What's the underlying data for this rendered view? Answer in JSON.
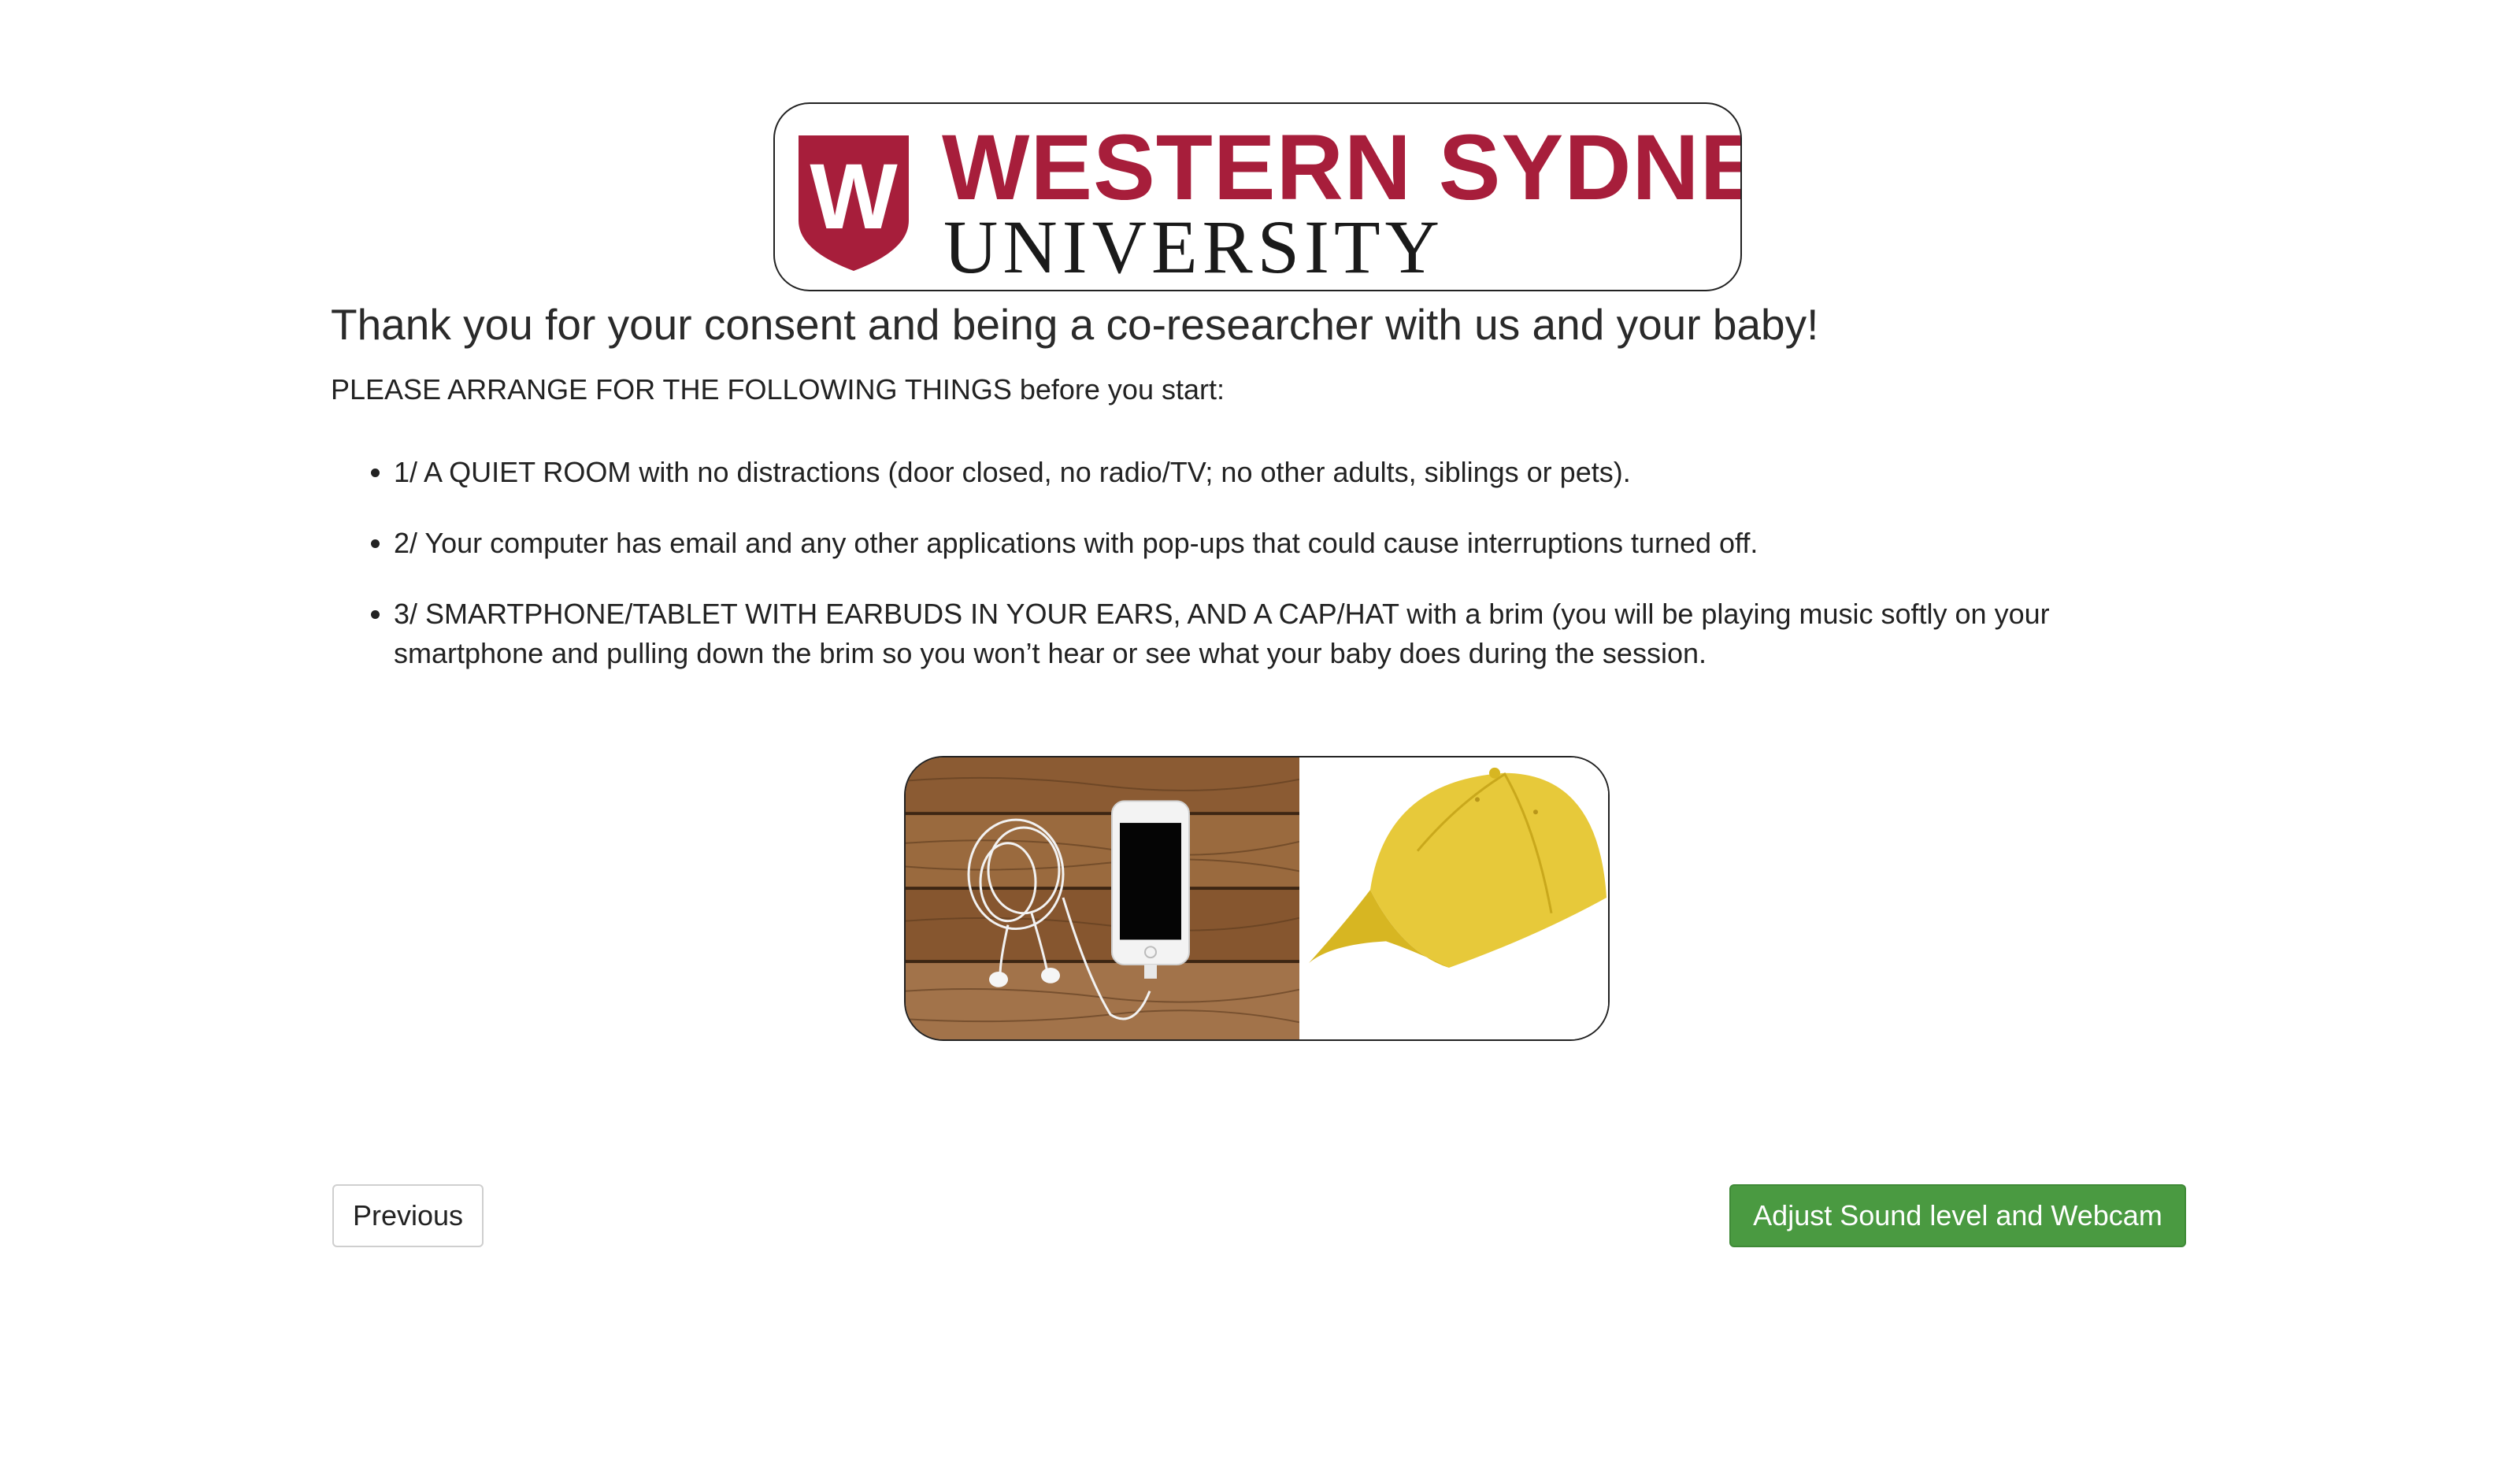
{
  "logo": {
    "shield_letter": "W",
    "line1": "WESTERN SYDNEY",
    "line2": "UNIVERSITY",
    "brand_color": "#a71e3b"
  },
  "main": {
    "headline": "Thank you for your consent and being a co-researcher with us and your baby!",
    "instructions": "PLEASE ARRANGE FOR THE FOLLOWING THINGS before you start:",
    "items": [
      "1/ A QUIET ROOM with no distractions (door closed, no radio/TV; no other adults, siblings or pets).",
      "2/ Your computer has email and any other applications with pop-ups that could cause interruptions turned off.",
      "3/ SMARTPHONE/TABLET WITH EARBUDS IN YOUR EARS, AND A CAP/HAT with a brim (you will be playing music softly on your smartphone and pulling down the brim so you won’t hear or see what your baby does during the session."
    ]
  },
  "images": {
    "left": "smartphone-with-earbuds-on-wood",
    "right": "yellow-cap"
  },
  "buttons": {
    "previous": "Previous",
    "next": "Adjust Sound level and Webcam",
    "next_color": "#4a9a41"
  }
}
